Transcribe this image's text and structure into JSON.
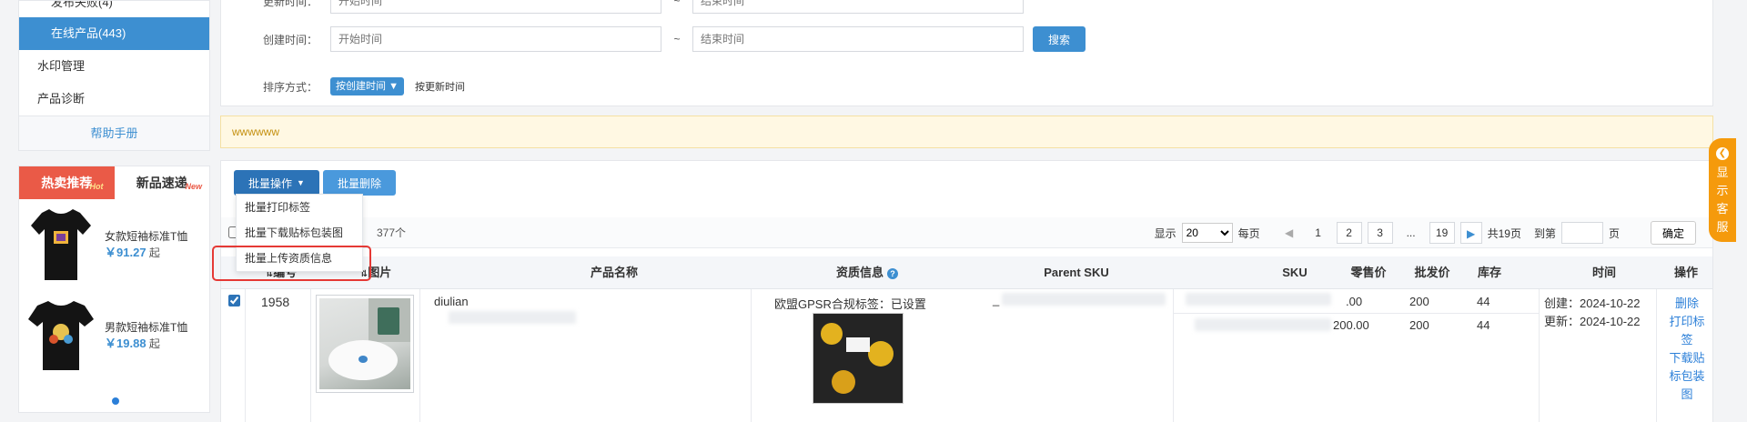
{
  "sidebar": {
    "menu": {
      "partial_item": "发布失败(4)",
      "active_item": "在线产品(443)",
      "items": [
        "水印管理",
        "产品诊断"
      ],
      "help": "帮助手册"
    },
    "promo": {
      "tabs": [
        {
          "label": "热卖推荐",
          "badge": "Hot"
        },
        {
          "label": "新品速递",
          "badge": "New"
        }
      ],
      "products": [
        {
          "name": "女款短袖标准T恤",
          "currency": "￥",
          "price": "91.27",
          "suffix": "起"
        },
        {
          "name": "男款短袖标准T恤",
          "currency": "￥",
          "price": "19.88",
          "suffix": "起"
        }
      ]
    }
  },
  "filters": {
    "update_time": {
      "label": "更新时间：",
      "start_placeholder": "开始时间",
      "end_placeholder": "结束时间"
    },
    "create_time": {
      "label": "创建时间：",
      "start_placeholder": "开始时间",
      "end_placeholder": "结束时间"
    },
    "separator": "~",
    "search_label": "搜索",
    "sort": {
      "label": "排序方式：",
      "active": "按创建时间",
      "alt": "按更新时间"
    }
  },
  "notice": "wwwwww",
  "batch": {
    "ops_label": "批量操作",
    "delete_label": "批量删除",
    "menu": [
      "批量打印标签",
      "批量下载贴标包装图",
      "批量上传资质信息"
    ]
  },
  "toolbar": {
    "total_text": "377个",
    "show_label": "显示",
    "page_size": "20",
    "per_page_label": "每页",
    "pages": [
      "1",
      "2",
      "3",
      "...",
      "19"
    ],
    "total_pages": "共19页",
    "goto_label": "到第",
    "page_unit": "页",
    "confirm_label": "确定"
  },
  "table": {
    "headers": {
      "no": "编号",
      "image": "图片",
      "name": "产品名称",
      "qual": "资质信息",
      "parent_sku": "Parent SKU",
      "sku": "SKU",
      "retail": "零售价",
      "wholesale": "批发价",
      "stock": "库存",
      "time": "时间",
      "ops": "操作"
    },
    "row": {
      "id": "1958",
      "name_visible": "diulian",
      "qual_text": "欧盟GPSR合规标签：已设置",
      "parent_sku_prefix": "_",
      "skus": [
        {
          "retail": ".00",
          "wholesale": "200",
          "stock": "44"
        },
        {
          "retail": "200.00",
          "wholesale": "200",
          "stock": "44"
        }
      ],
      "create_label": "创建：",
      "create_date": "2024-10-22",
      "update_label": "更新：",
      "update_date": "2024-10-22",
      "ops": [
        "删除",
        "打印标签",
        "下载贴标包装图"
      ]
    }
  },
  "service": {
    "label": "显示客服"
  },
  "colors": {
    "primary": "#3d8fd1",
    "hot": "#ea5a47",
    "service": "#f59a0c",
    "highlight": "#e53935"
  }
}
